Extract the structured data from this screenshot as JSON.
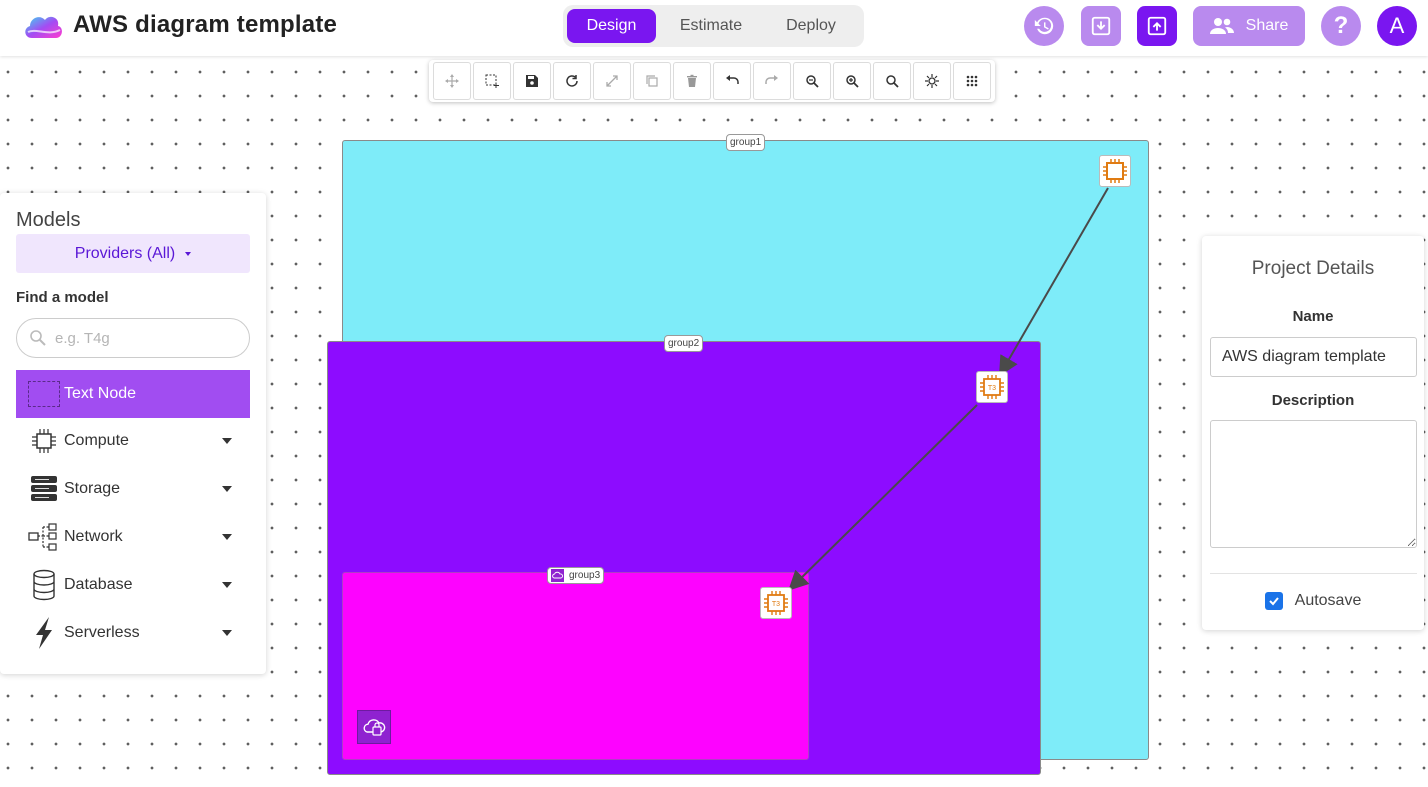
{
  "header": {
    "title": "AWS diagram template",
    "tabs": [
      {
        "label": "Design",
        "active": true
      },
      {
        "label": "Estimate",
        "active": false
      },
      {
        "label": "Deploy",
        "active": false
      }
    ],
    "buttons": {
      "history": "history-icon",
      "download": "download-icon",
      "upload": "upload-icon",
      "share_label": "Share",
      "help": "?",
      "avatar": "A"
    },
    "colors": {
      "accent": "#7a16f0",
      "accent_light": "#b98aee"
    }
  },
  "toolbar": {
    "tools": [
      "move-icon",
      "select-icon",
      "save-icon",
      "refresh-icon",
      "expand-icon",
      "copy-icon",
      "delete-icon",
      "undo-icon",
      "redo-icon",
      "zoom-out-icon",
      "zoom-in-icon",
      "zoom-reset-icon",
      "settings-icon",
      "grid-icon"
    ]
  },
  "diagram": {
    "groups": [
      {
        "label": "group1",
        "color": "#7eecf9"
      },
      {
        "label": "group2",
        "color": "#8d0cff"
      },
      {
        "label": "group3",
        "color": "#fd03ff"
      }
    ],
    "nodes": [
      {
        "label": "",
        "icon": "ec2-chip-icon"
      },
      {
        "label": "T3",
        "icon": "ec2-t3-icon"
      },
      {
        "label": "T3",
        "icon": "ec2-t3-icon"
      }
    ],
    "badge_icon": "cloud-lock-icon"
  },
  "models": {
    "title": "Models",
    "providers": "Providers (All)",
    "find_label": "Find a model",
    "search_placeholder": "e.g. T4g",
    "text_node": "Text Node",
    "categories": [
      {
        "label": "Compute",
        "icon": "chip-icon"
      },
      {
        "label": "Storage",
        "icon": "server-icon"
      },
      {
        "label": "Network",
        "icon": "network-icon"
      },
      {
        "label": "Database",
        "icon": "database-icon"
      },
      {
        "label": "Serverless",
        "icon": "lightning-icon"
      }
    ]
  },
  "project": {
    "title": "Project Details",
    "name_label": "Name",
    "name_value": "AWS diagram template",
    "description_label": "Description",
    "description_value": "",
    "autosave_label": "Autosave",
    "autosave_checked": true
  }
}
